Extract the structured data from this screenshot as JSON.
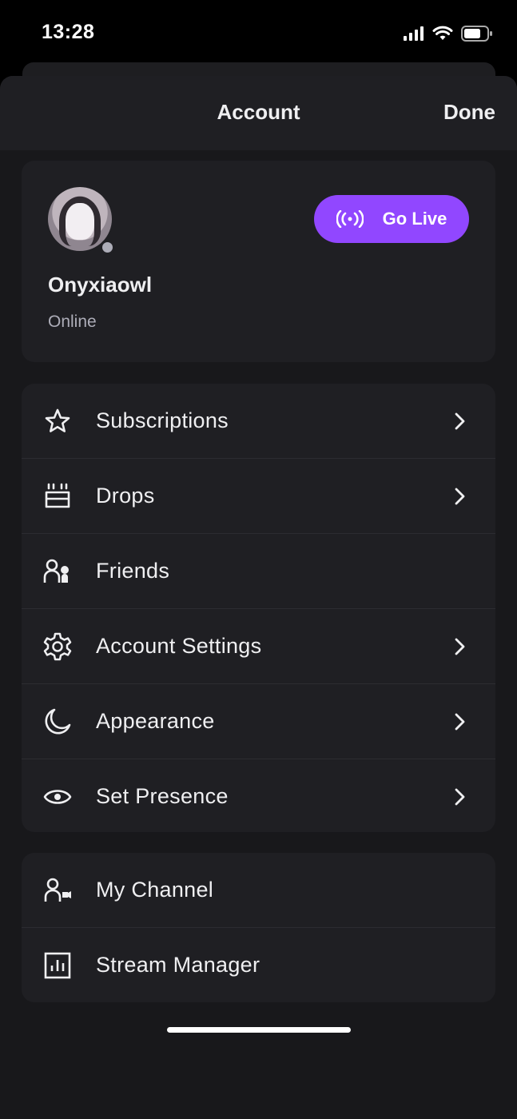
{
  "status_bar": {
    "time": "13:28"
  },
  "nav": {
    "title": "Account",
    "done_label": "Done"
  },
  "profile": {
    "username": "Onyxiaowl",
    "status": "Online",
    "go_live_label": "Go Live"
  },
  "menu": [
    {
      "label": "Subscriptions",
      "icon": "star-icon",
      "has_chevron": true
    },
    {
      "label": "Drops",
      "icon": "drops-icon",
      "has_chevron": true
    },
    {
      "label": "Friends",
      "icon": "friends-icon",
      "has_chevron": false
    },
    {
      "label": "Account Settings",
      "icon": "gear-icon",
      "has_chevron": true
    },
    {
      "label": "Appearance",
      "icon": "moon-icon",
      "has_chevron": true
    },
    {
      "label": "Set Presence",
      "icon": "eye-icon",
      "has_chevron": true
    }
  ],
  "channel_menu": [
    {
      "label": "My Channel",
      "icon": "channel-icon"
    },
    {
      "label": "Stream Manager",
      "icon": "stream-manager-icon"
    }
  ],
  "colors": {
    "accent": "#9147ff",
    "sheet_background": "#18181b",
    "card_background": "#1f1f23",
    "secondary_text": "#adadb8"
  }
}
